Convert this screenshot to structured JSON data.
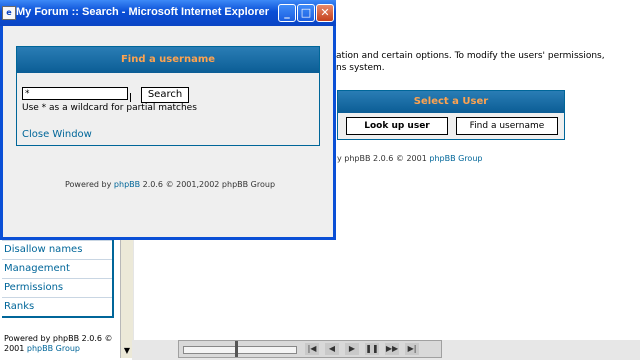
{
  "popup": {
    "title": "My Forum :: Search - Microsoft Internet Explorer",
    "find_header": "Find a username",
    "search_value": "*",
    "search_button": "Search",
    "hint": "Use * as a wildcard for partial matches",
    "close_link": "Close Window",
    "powered_prefix": "Powered by ",
    "powered_link": "phpBB",
    "powered_suffix": " 2.0.6 © 2001,2002 phpBB Group"
  },
  "background": {
    "desc_line1": "ation and certain options. To modify the users' permissions,",
    "desc_line2": "ns system.",
    "select_user_header": "Select a User",
    "lookup_button": "Look up user",
    "find_username_button": "Find a username",
    "powered_text_a": "y phpBB 2.0.6 © 2001 ",
    "powered_link": "phpBB Group"
  },
  "nav": {
    "items": [
      {
        "label": "Disallow names"
      },
      {
        "label": "Management"
      },
      {
        "label": "Permissions"
      },
      {
        "label": "Ranks"
      }
    ],
    "powered_line1": "Powered by phpBB 2.0.6 ©",
    "powered_line2_a": "2001 ",
    "powered_line2_link": "phpBB Group"
  },
  "media": {
    "controls": [
      "|◀",
      "◀",
      "▶",
      "❚❚",
      "▶▶",
      "▶|"
    ]
  },
  "colors": {
    "header_blue": "#0b5d95",
    "header_text": "#ffa34f",
    "link": "#006699"
  }
}
